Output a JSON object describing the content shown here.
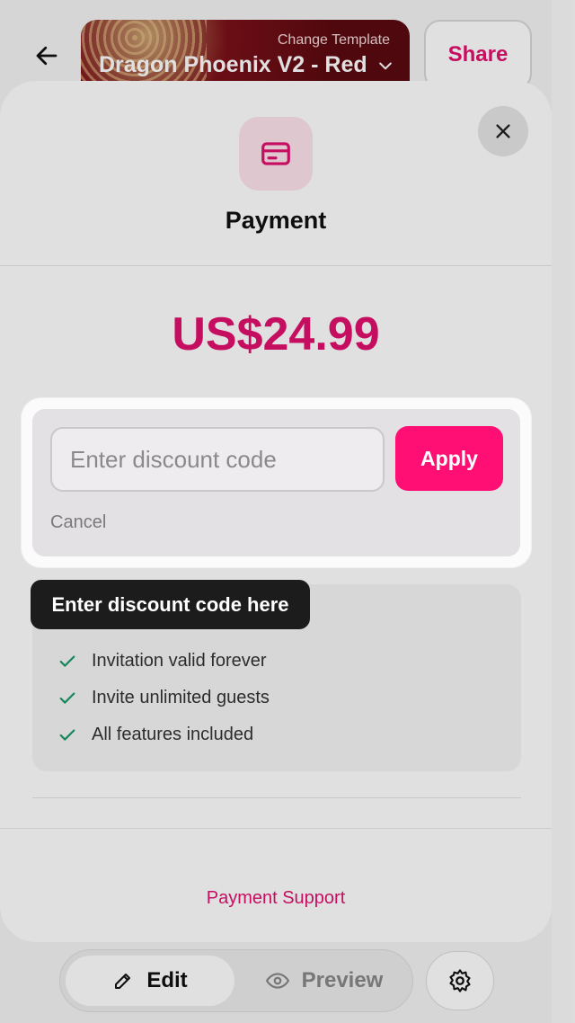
{
  "header": {
    "template_label": "Change Template",
    "template_name": "Dragon Phoenix V2 - Red",
    "share_label": "Share"
  },
  "modal": {
    "title": "Payment",
    "price": "US$24.99",
    "discount": {
      "placeholder": "Enter discount code",
      "value": "",
      "apply_label": "Apply",
      "cancel_label": "Cancel"
    },
    "tooltip": "Enter discount code here",
    "features": [
      {
        "label": "Invitation valid forever",
        "icon": "check-icon"
      },
      {
        "label": "Invite unlimited guests",
        "icon": "check-icon"
      },
      {
        "label": "All features included",
        "icon": "check-icon"
      }
    ],
    "support_label": "Payment Support"
  },
  "bottom_nav": {
    "edit_label": "Edit",
    "preview_label": "Preview"
  },
  "colors": {
    "accent": "#e2116e",
    "apply_button": "#ff0f74",
    "check": "#1a9a6a"
  }
}
